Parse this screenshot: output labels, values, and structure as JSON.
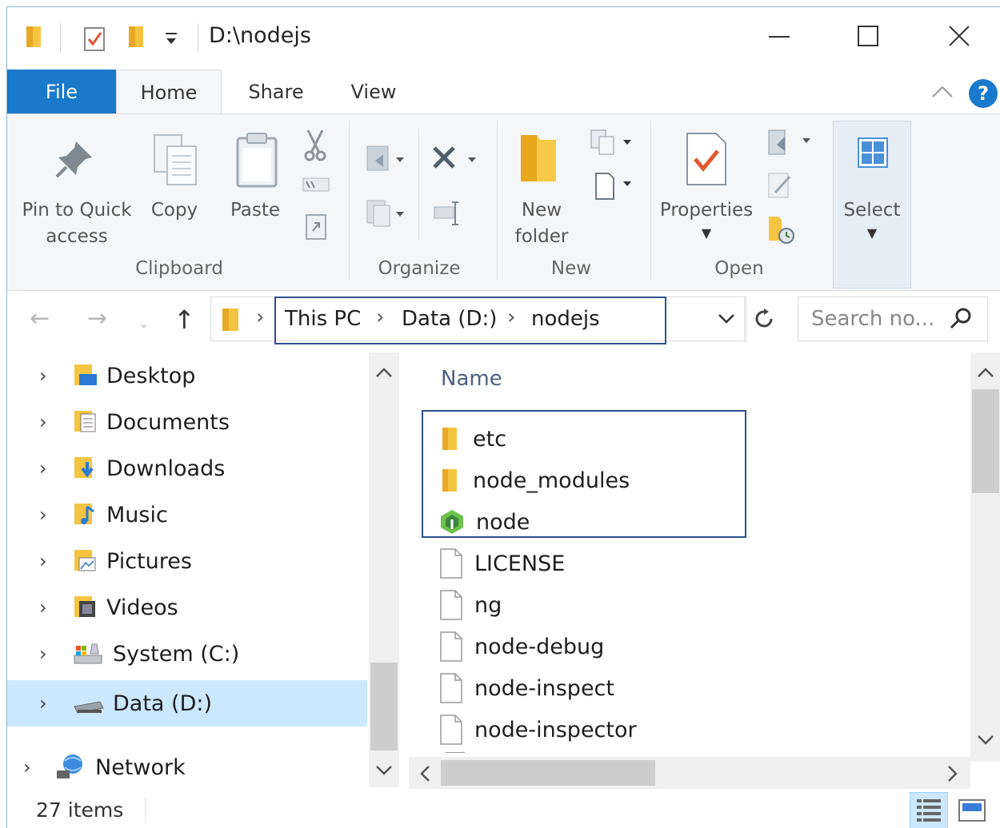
{
  "window": {
    "title": "D:\\nodejs",
    "minimize_icon": "minimize-icon",
    "maximize_icon": "maximize-icon",
    "close_icon": "close-icon"
  },
  "ribbon_tabs": [
    "File",
    "Home",
    "Share",
    "View"
  ],
  "ribbon": {
    "clipboard": {
      "pin_label_1": "Pin to Quick",
      "pin_label_2": "access",
      "copy": "Copy",
      "paste": "Paste",
      "group": "Clipboard"
    },
    "organize": {
      "group": "Organize"
    },
    "new": {
      "folder_1": "New",
      "folder_2": "folder",
      "group": "New"
    },
    "open": {
      "properties": "Properties",
      "group": "Open"
    },
    "select": {
      "label": "Select"
    },
    "help": "?"
  },
  "address": {
    "crumbs": [
      "This PC",
      "Data (D:)",
      "nodejs"
    ],
    "search_placeholder": "Search no..."
  },
  "nav_pane": [
    {
      "label": "Desktop",
      "icon": "desktop-folder-icon"
    },
    {
      "label": "Documents",
      "icon": "documents-folder-icon"
    },
    {
      "label": "Downloads",
      "icon": "downloads-folder-icon"
    },
    {
      "label": "Music",
      "icon": "music-folder-icon"
    },
    {
      "label": "Pictures",
      "icon": "pictures-folder-icon"
    },
    {
      "label": "Videos",
      "icon": "videos-folder-icon"
    },
    {
      "label": "System (C:)",
      "icon": "system-drive-icon"
    },
    {
      "label": "Data (D:)",
      "icon": "data-drive-icon",
      "selected": true
    },
    {
      "label": "Network",
      "icon": "network-icon"
    }
  ],
  "file_list": {
    "column": "Name",
    "items": [
      {
        "name": "etc",
        "icon": "folder-icon"
      },
      {
        "name": "node_modules",
        "icon": "folder-icon"
      },
      {
        "name": "node",
        "icon": "nodejs-icon"
      },
      {
        "name": "LICENSE",
        "icon": "file-icon"
      },
      {
        "name": "ng",
        "icon": "file-icon"
      },
      {
        "name": "node-debug",
        "icon": "file-icon"
      },
      {
        "name": "node-inspect",
        "icon": "file-icon"
      },
      {
        "name": "node-inspector",
        "icon": "file-icon"
      }
    ]
  },
  "status": {
    "count": "27 items"
  },
  "colors": {
    "file_tab": "#1979ca",
    "highlight_box": "#2f4f8f",
    "selected_nav": "#cce8ff"
  }
}
